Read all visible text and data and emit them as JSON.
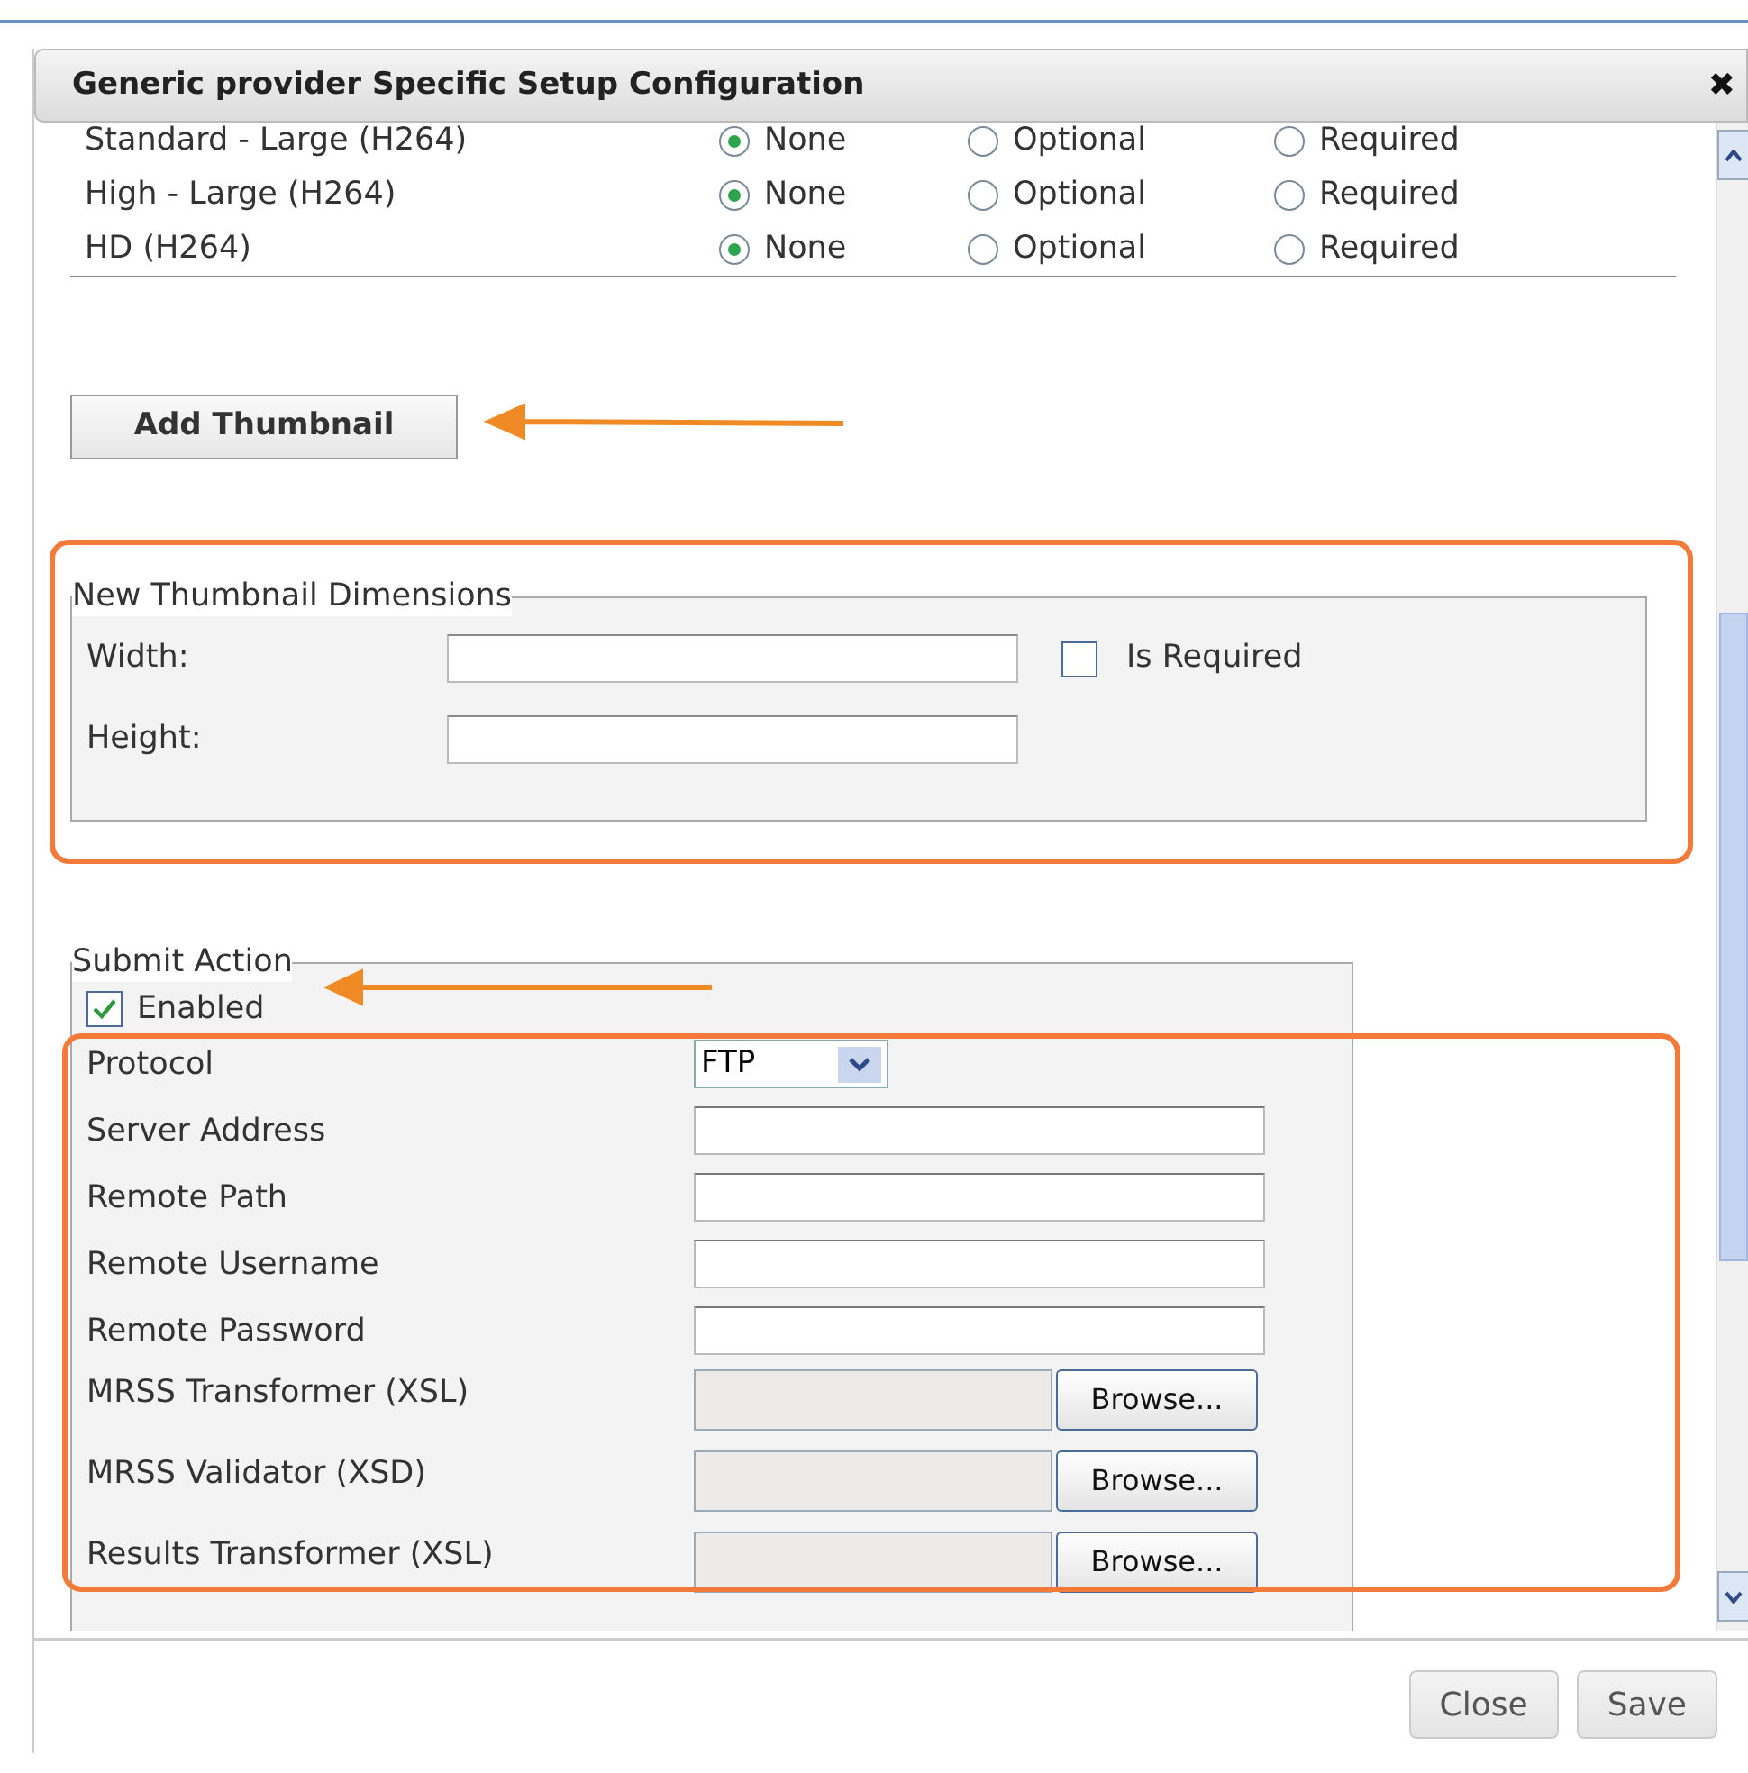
{
  "dialog": {
    "title": "Generic provider Specific Setup Configuration",
    "close_glyph": "✖"
  },
  "profiles": [
    {
      "name": "Standard - Large (H264)",
      "options": [
        {
          "label": "None",
          "selected": true
        },
        {
          "label": "Optional",
          "selected": false
        },
        {
          "label": "Required",
          "selected": false
        }
      ]
    },
    {
      "name": "High - Large (H264)",
      "options": [
        {
          "label": "None",
          "selected": true
        },
        {
          "label": "Optional",
          "selected": false
        },
        {
          "label": "Required",
          "selected": false
        }
      ]
    },
    {
      "name": "HD (H264)",
      "options": [
        {
          "label": "None",
          "selected": true
        },
        {
          "label": "Optional",
          "selected": false
        },
        {
          "label": "Required",
          "selected": false
        }
      ]
    }
  ],
  "add_thumbnail_button": "Add Thumbnail",
  "thumbnail_dimensions": {
    "legend": "New Thumbnail Dimensions",
    "fields": [
      {
        "label": "Width:"
      },
      {
        "label": "Height:"
      }
    ],
    "is_required": {
      "label": "Is Required",
      "checked": false
    }
  },
  "submit_action": {
    "legend": "Submit Action",
    "enabled": {
      "label": "Enabled",
      "checked": true
    },
    "fields": [
      {
        "kind": "select",
        "label": "Protocol",
        "value": "FTP"
      },
      {
        "kind": "text",
        "label": "Server Address"
      },
      {
        "kind": "text",
        "label": "Remote Path"
      },
      {
        "kind": "text",
        "label": "Remote Username"
      },
      {
        "kind": "text",
        "label": "Remote Password"
      },
      {
        "kind": "file",
        "label": "MRSS Transformer (XSL)",
        "button": "Browse..."
      },
      {
        "kind": "file",
        "label": "MRSS Validator (XSD)",
        "button": "Browse..."
      },
      {
        "kind": "file",
        "label": "Results Transformer (XSL)",
        "button": "Browse..."
      }
    ]
  },
  "footer_buttons": [
    {
      "label": "Close"
    },
    {
      "label": "Save"
    }
  ]
}
